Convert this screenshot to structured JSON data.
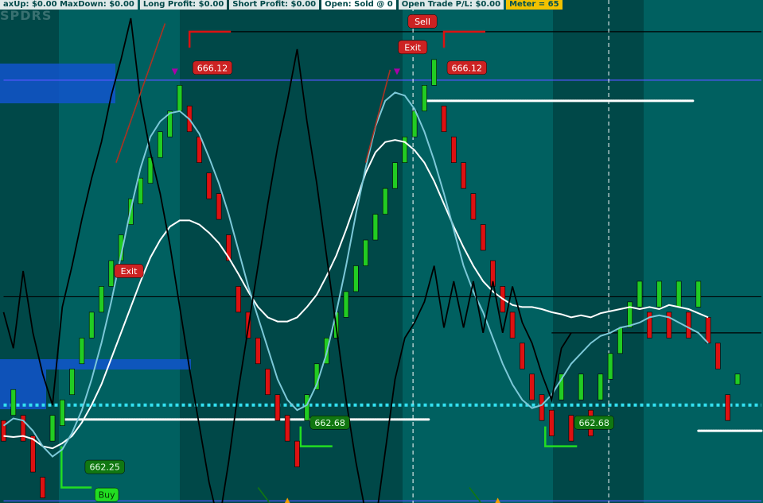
{
  "topbar": {
    "maxupdown": "axUp: $0.00 MaxDown: $0.00",
    "long_profit": "Long Profit: $0.00",
    "short_profit": "Short Profit: $0.00",
    "open": "Open: Sold @ 0",
    "open_trade": "Open Trade P/L: $0.00",
    "meter": "Meter = 65"
  },
  "watermark": "SPDRS",
  "colors": {
    "background": "#006060",
    "dark_zone": "#004848",
    "up": "#22cc22",
    "down": "#dd1111",
    "blue_zone": "#1155cc",
    "dotted_line": "#33e0f0",
    "white_line": "#ffffff",
    "light_line": "#7cc8d8",
    "label_red": "#cc2222",
    "label_green": "#117711",
    "buy_green": "#22dd22",
    "arrow_orange": "#f2a000"
  },
  "chart_data": {
    "type": "candlestick",
    "title": "",
    "xlabel": "",
    "ylabel": "",
    "ylim": [
      661.9,
      666.7
    ],
    "grid": false,
    "bars": [
      {
        "o": 662.7,
        "c": 662.5,
        "dir": "down"
      },
      {
        "o": 662.75,
        "c": 663.0,
        "dir": "up"
      },
      {
        "o": 662.75,
        "c": 662.5,
        "dir": "down"
      },
      {
        "o": 662.55,
        "c": 662.2,
        "dir": "down"
      },
      {
        "o": 662.15,
        "c": 661.95,
        "dir": "down"
      },
      {
        "o": 662.5,
        "c": 662.75,
        "dir": "up"
      },
      {
        "o": 662.65,
        "c": 662.9,
        "dir": "up"
      },
      {
        "o": 662.95,
        "c": 663.2,
        "dir": "up"
      },
      {
        "o": 663.25,
        "c": 663.5,
        "dir": "up"
      },
      {
        "o": 663.5,
        "c": 663.75,
        "dir": "up"
      },
      {
        "o": 663.75,
        "c": 664.0,
        "dir": "up"
      },
      {
        "o": 664.0,
        "c": 664.25,
        "dir": "up"
      },
      {
        "o": 664.25,
        "c": 664.5,
        "dir": "up"
      },
      {
        "o": 664.6,
        "c": 664.85,
        "dir": "up"
      },
      {
        "o": 664.8,
        "c": 665.05,
        "dir": "up"
      },
      {
        "o": 665.0,
        "c": 665.25,
        "dir": "up"
      },
      {
        "o": 665.25,
        "c": 665.5,
        "dir": "up"
      },
      {
        "o": 665.45,
        "c": 665.7,
        "dir": "up"
      },
      {
        "o": 665.7,
        "c": 665.95,
        "dir": "up"
      },
      {
        "o": 665.75,
        "c": 665.5,
        "dir": "down"
      },
      {
        "o": 665.45,
        "c": 665.2,
        "dir": "down"
      },
      {
        "o": 665.1,
        "c": 664.85,
        "dir": "down"
      },
      {
        "o": 664.9,
        "c": 664.65,
        "dir": "down"
      },
      {
        "o": 664.5,
        "c": 664.25,
        "dir": "down"
      },
      {
        "o": 664.0,
        "c": 663.75,
        "dir": "down"
      },
      {
        "o": 663.75,
        "c": 663.5,
        "dir": "down"
      },
      {
        "o": 663.5,
        "c": 663.25,
        "dir": "down"
      },
      {
        "o": 663.2,
        "c": 662.95,
        "dir": "down"
      },
      {
        "o": 662.95,
        "c": 662.7,
        "dir": "down"
      },
      {
        "o": 662.75,
        "c": 662.5,
        "dir": "down"
      },
      {
        "o": 662.5,
        "c": 662.25,
        "dir": "down"
      },
      {
        "o": 662.7,
        "c": 662.95,
        "dir": "up"
      },
      {
        "o": 663.0,
        "c": 663.25,
        "dir": "up"
      },
      {
        "o": 663.25,
        "c": 663.5,
        "dir": "up"
      },
      {
        "o": 663.5,
        "c": 663.75,
        "dir": "up"
      },
      {
        "o": 663.7,
        "c": 663.95,
        "dir": "up"
      },
      {
        "o": 663.95,
        "c": 664.2,
        "dir": "up"
      },
      {
        "o": 664.2,
        "c": 664.45,
        "dir": "up"
      },
      {
        "o": 664.45,
        "c": 664.7,
        "dir": "up"
      },
      {
        "o": 664.7,
        "c": 664.95,
        "dir": "up"
      },
      {
        "o": 664.95,
        "c": 665.2,
        "dir": "up"
      },
      {
        "o": 665.2,
        "c": 665.45,
        "dir": "up"
      },
      {
        "o": 665.45,
        "c": 665.7,
        "dir": "up"
      },
      {
        "o": 665.7,
        "c": 665.95,
        "dir": "up"
      },
      {
        "o": 665.95,
        "c": 666.2,
        "dir": "up"
      },
      {
        "o": 665.75,
        "c": 665.5,
        "dir": "down"
      },
      {
        "o": 665.45,
        "c": 665.2,
        "dir": "down"
      },
      {
        "o": 665.2,
        "c": 664.95,
        "dir": "down"
      },
      {
        "o": 664.9,
        "c": 664.65,
        "dir": "down"
      },
      {
        "o": 664.6,
        "c": 664.35,
        "dir": "down"
      },
      {
        "o": 664.25,
        "c": 664.0,
        "dir": "down"
      },
      {
        "o": 664.0,
        "c": 663.75,
        "dir": "down"
      },
      {
        "o": 663.75,
        "c": 663.5,
        "dir": "down"
      },
      {
        "o": 663.45,
        "c": 663.2,
        "dir": "down"
      },
      {
        "o": 663.15,
        "c": 662.9,
        "dir": "down"
      },
      {
        "o": 662.95,
        "c": 662.7,
        "dir": "down"
      },
      {
        "o": 662.8,
        "c": 662.55,
        "dir": "down"
      },
      {
        "o": 662.9,
        "c": 663.15,
        "dir": "up"
      },
      {
        "o": 662.75,
        "c": 662.5,
        "dir": "down"
      },
      {
        "o": 662.9,
        "c": 663.15,
        "dir": "up"
      },
      {
        "o": 662.8,
        "c": 662.55,
        "dir": "down"
      },
      {
        "o": 662.9,
        "c": 663.15,
        "dir": "up"
      },
      {
        "o": 663.1,
        "c": 663.35,
        "dir": "up"
      },
      {
        "o": 663.35,
        "c": 663.6,
        "dir": "up"
      },
      {
        "o": 663.6,
        "c": 663.85,
        "dir": "up"
      },
      {
        "o": 663.8,
        "c": 664.05,
        "dir": "up"
      },
      {
        "o": 663.75,
        "c": 663.5,
        "dir": "down"
      },
      {
        "o": 663.8,
        "c": 664.05,
        "dir": "up"
      },
      {
        "o": 663.75,
        "c": 663.5,
        "dir": "down"
      },
      {
        "o": 663.8,
        "c": 664.05,
        "dir": "up"
      },
      {
        "o": 663.75,
        "c": 663.5,
        "dir": "down"
      },
      {
        "o": 663.8,
        "c": 664.05,
        "dir": "up"
      },
      {
        "o": 663.7,
        "c": 663.45,
        "dir": "down"
      },
      {
        "o": 663.45,
        "c": 663.2,
        "dir": "down"
      },
      {
        "o": 662.95,
        "c": 662.7,
        "dir": "down"
      },
      {
        "o": 663.05,
        "c": 663.15,
        "dir": "up"
      }
    ],
    "labels": [
      {
        "text": "666.12",
        "kind": "red",
        "bar": 19,
        "y": 666.12
      },
      {
        "text": "666.12",
        "kind": "red",
        "bar": 45,
        "y": 666.12
      },
      {
        "text": "Exit",
        "kind": "red",
        "bar": 11,
        "y": 664.15
      },
      {
        "text": "Exit",
        "kind": "red",
        "bar": 40,
        "y": 666.32
      },
      {
        "text": "Sell",
        "kind": "red",
        "bar": 41,
        "y": 666.57
      },
      {
        "text": "662.68",
        "kind": "green",
        "bar": 31,
        "y": 662.68
      },
      {
        "text": "662.68",
        "kind": "green",
        "bar": 58,
        "y": 662.68
      },
      {
        "text": "662.25",
        "kind": "green",
        "bar": 8,
        "y": 662.25
      },
      {
        "text": "Buy",
        "kind": "buy",
        "bar": 9,
        "y": 661.98
      }
    ],
    "hlines": [
      {
        "y": 666.47,
        "color": "#000000",
        "from_bar": 19,
        "to_bar": 75
      },
      {
        "y": 666.0,
        "color": "#5555ff",
        "from_bar": 0,
        "to_bar": 75
      },
      {
        "y": 663.9,
        "color": "#000000",
        "from_bar": 0,
        "to_bar": 75
      },
      {
        "y": 663.55,
        "color": "#000000",
        "from_bar": 56,
        "to_bar": 75
      },
      {
        "y": 662.85,
        "color": "#33e0f0",
        "dotted": true,
        "from_bar": 0,
        "to_bar": 75
      },
      {
        "y": 662.71,
        "color": "#ffffff",
        "from_bar": 6,
        "to_bar": 41,
        "thick": true
      },
      {
        "y": 665.8,
        "color": "#ffffff",
        "from_bar": 43,
        "to_bar": 68,
        "thick": true
      },
      {
        "y": 662.6,
        "color": "#ffffff",
        "from_bar": 71,
        "to_bar": 75,
        "thick": true
      },
      {
        "y": 661.92,
        "color": "#5555ff",
        "from_bar": 0,
        "to_bar": 75
      }
    ],
    "vlines": [
      42,
      62
    ],
    "series": [
      {
        "key": "slow",
        "color": "#ffffff",
        "values": [
          662.55,
          662.54,
          662.55,
          662.52,
          662.45,
          662.43,
          662.48,
          662.55,
          662.68,
          662.85,
          663.05,
          663.3,
          663.55,
          663.8,
          664.05,
          664.28,
          664.45,
          664.58,
          664.64,
          664.64,
          664.6,
          664.52,
          664.42,
          664.28,
          664.12,
          663.95,
          663.8,
          663.7,
          663.66,
          663.66,
          663.7,
          663.8,
          663.92,
          664.1,
          664.3,
          664.55,
          664.82,
          665.1,
          665.3,
          665.4,
          665.42,
          665.4,
          665.32,
          665.2,
          665.02,
          664.8,
          664.58,
          664.38,
          664.2,
          664.05,
          663.95,
          663.88,
          663.82,
          663.8,
          663.8,
          663.78,
          663.75,
          663.73,
          663.7,
          663.72,
          663.7,
          663.74,
          663.76,
          663.78,
          663.8,
          663.78,
          663.8,
          663.78,
          663.82,
          663.8,
          663.78,
          663.74,
          663.7
        ]
      },
      {
        "key": "fast",
        "color": "#7cc8d8",
        "values": [
          662.65,
          662.72,
          662.7,
          662.6,
          662.45,
          662.35,
          662.42,
          662.58,
          662.8,
          663.1,
          663.45,
          663.85,
          664.3,
          664.75,
          665.15,
          665.45,
          665.6,
          665.68,
          665.7,
          665.62,
          665.48,
          665.25,
          665.0,
          664.7,
          664.35,
          664.0,
          663.7,
          663.4,
          663.1,
          662.9,
          662.8,
          662.85,
          663.05,
          663.35,
          663.75,
          664.2,
          664.7,
          665.15,
          665.55,
          665.8,
          665.88,
          665.85,
          665.72,
          665.5,
          665.22,
          664.9,
          664.55,
          664.2,
          663.95,
          663.75,
          663.5,
          663.25,
          663.05,
          662.9,
          662.82,
          662.85,
          662.95,
          663.1,
          663.25,
          663.35,
          663.45,
          663.52,
          663.55,
          663.6,
          663.62,
          663.65,
          663.7,
          663.72,
          663.7,
          663.65,
          663.6,
          663.55,
          663.45
        ]
      },
      {
        "key": "black",
        "color": "#000000",
        "values": [
          663.75,
          663.4,
          664.15,
          663.55,
          663.15,
          662.85,
          663.8,
          664.2,
          664.65,
          665.05,
          665.4,
          665.85,
          666.2,
          666.6,
          665.8,
          665.3,
          664.9,
          664.4,
          663.8,
          663.2,
          662.65,
          662.1,
          661.7,
          662.3,
          663.0,
          663.6,
          664.2,
          664.8,
          665.35,
          665.8,
          666.3,
          665.6,
          665.0,
          664.3,
          663.6,
          662.9,
          662.3,
          661.8,
          661.7,
          662.4,
          663.1,
          663.5,
          663.65,
          663.85,
          664.2,
          663.6,
          664.05,
          663.6,
          664.05,
          663.55,
          664.05,
          663.55,
          664.0,
          663.65,
          663.45,
          663.15,
          662.9,
          663.4,
          663.55
        ]
      }
    ]
  }
}
